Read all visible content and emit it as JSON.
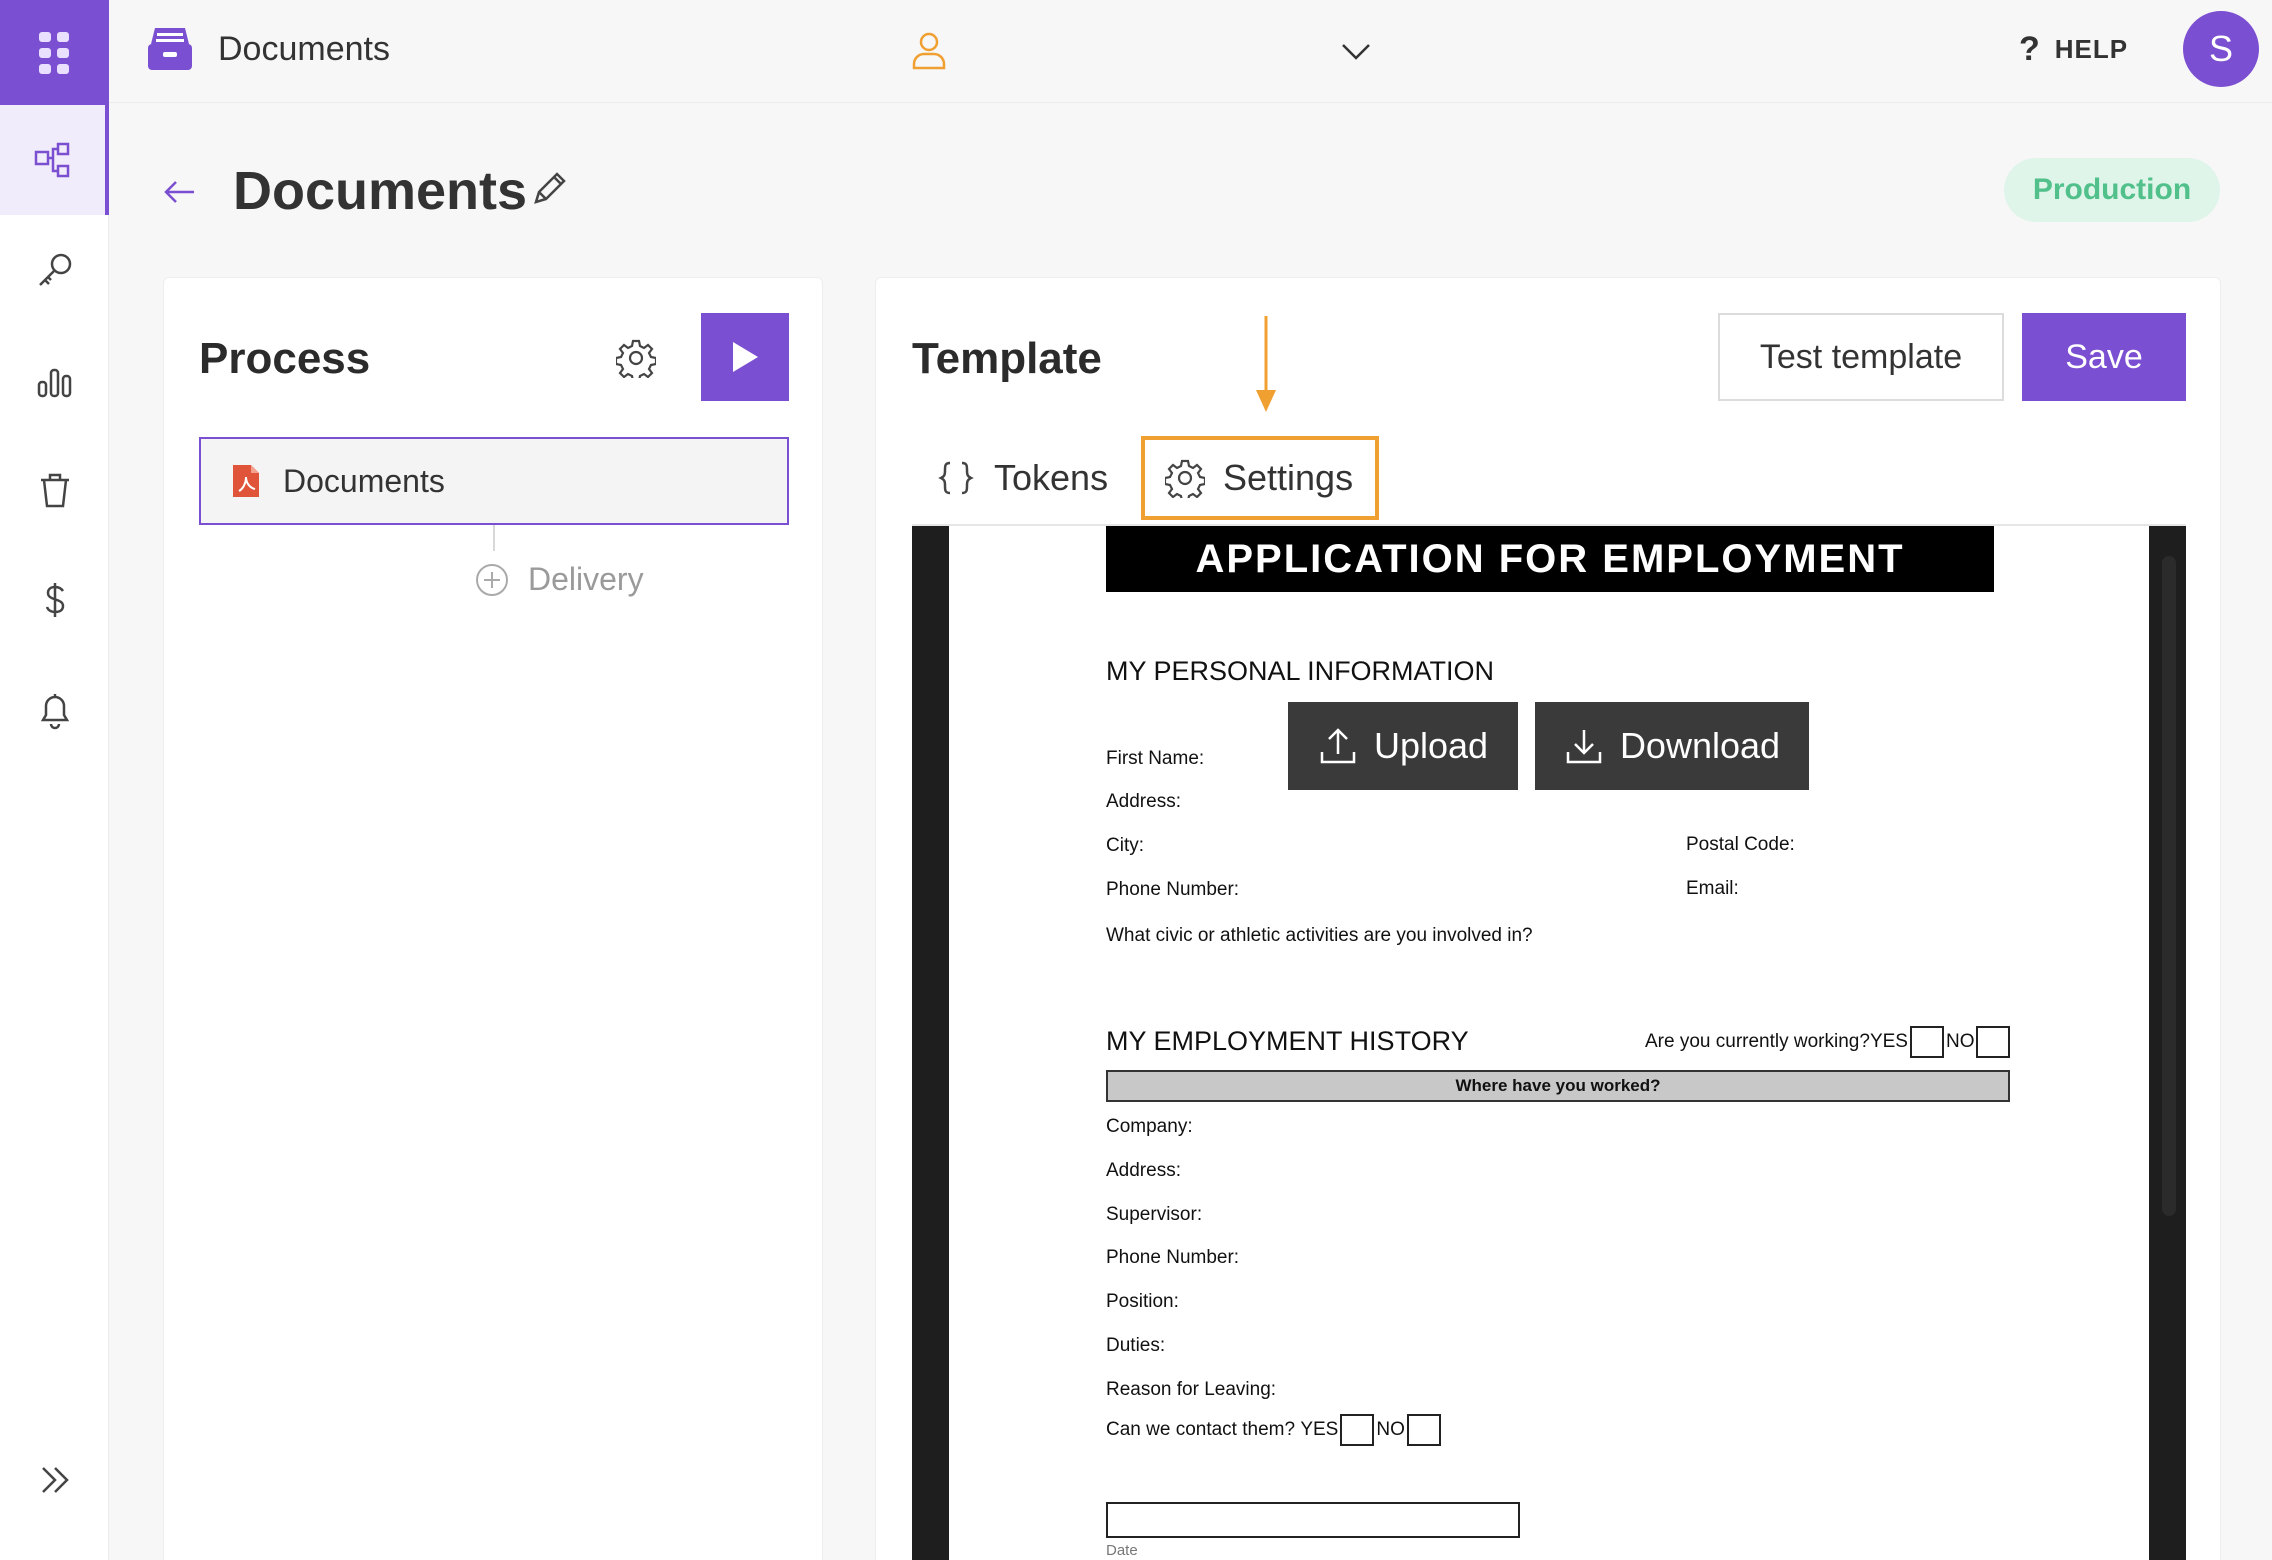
{
  "topbar": {
    "app_title": "Documents",
    "help_label": "HELP",
    "avatar_initial": "S"
  },
  "header": {
    "title": "Documents",
    "environment": "Production"
  },
  "process": {
    "title": "Process",
    "steps": [
      {
        "label": "Documents"
      }
    ],
    "add_step_label": "Delivery"
  },
  "template": {
    "title": "Template",
    "test_label": "Test template",
    "save_label": "Save",
    "tabs": [
      {
        "label": "Tokens"
      },
      {
        "label": "Settings"
      }
    ],
    "upload_label": "Upload",
    "download_label": "Download"
  },
  "document": {
    "banner": "APPLICATION FOR EMPLOYMENT",
    "personal_title": "MY PERSONAL INFORMATION",
    "first_name": "First Name:",
    "address": "Address:",
    "city": "City:",
    "postal_code": "Postal Code:",
    "phone": "Phone Number:",
    "email": "Email:",
    "activities": "What civic or athletic activities are you involved in?",
    "employment_title": "MY EMPLOYMENT HISTORY",
    "currently_working": "Are you currently working?",
    "yes": "YES",
    "no": "NO",
    "worked_bar": "Where have you worked?",
    "company": "Company:",
    "address2": "Address:",
    "supervisor": "Supervisor:",
    "phone2": "Phone Number:",
    "position": "Position:",
    "duties": "Duties:",
    "reason": "Reason for Leaving:",
    "contact": "Can we contact them?",
    "date_label": "Date"
  },
  "colors": {
    "accent": "#7b4fd1",
    "highlight": "#f0a031",
    "production": "#52c08b"
  }
}
